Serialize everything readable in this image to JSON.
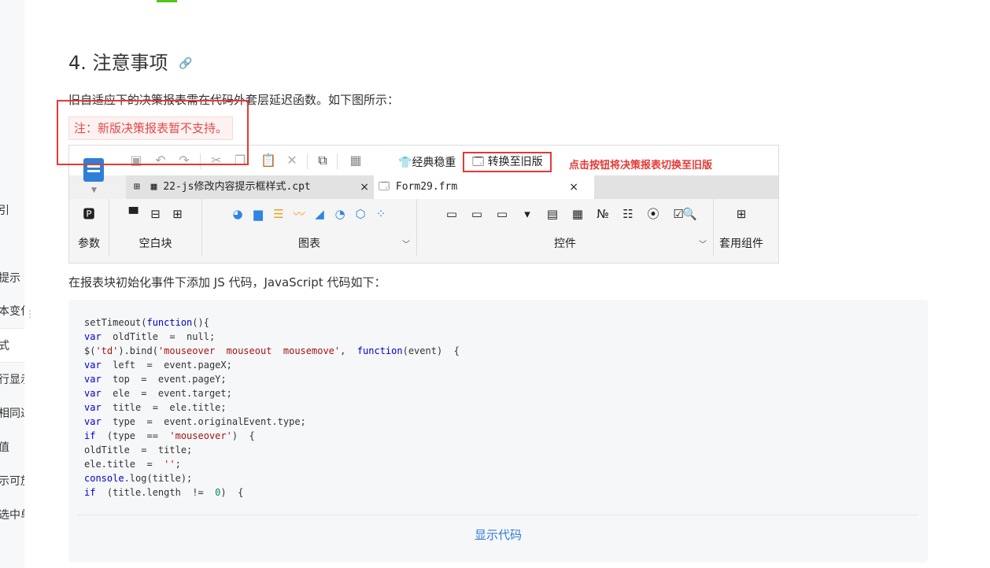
{
  "sidebar": {
    "items": [
      "引",
      "提示",
      "本变化",
      "式",
      "行显示",
      "相同过",
      "值",
      "示可放",
      "选中单"
    ]
  },
  "section": {
    "heading": "4. 注意事项",
    "link_icon": "link-icon",
    "para1": "旧自适应下的决策报表需在代码外套层延迟函数。如下图所示：",
    "note": "注：新版决策报表暂不支持。",
    "para2": "在报表块初始化事件下添加 JS 代码，JavaScript 代码如下："
  },
  "screenshot": {
    "classic_label": "经典稳重",
    "to_old_button": "转换至旧版",
    "annotation": "点击按钮将决策报表切换至旧版",
    "tabs": [
      {
        "label": "22-js修改内容提示框样式.cpt",
        "close": "×"
      },
      {
        "label": "Form29.frm",
        "close": "×"
      }
    ],
    "groups": [
      {
        "label": "参数"
      },
      {
        "label": "空白块"
      },
      {
        "label": "图表"
      },
      {
        "label": "控件"
      },
      {
        "label": "套用组件"
      }
    ]
  },
  "code": {
    "lines": [
      "setTimeout(function(){",
      "var  oldTitle  =  null;",
      "$('td').bind('mouseover  mouseout  mousemove',  function(event)  {",
      "var  left  =  event.pageX;",
      "var  top  =  event.pageY;",
      "var  ele  =  event.target;",
      "var  title  =  ele.title;",
      "var  type  =  event.originalEvent.type;",
      "if  (type  ==  'mouseover')  {",
      "oldTitle  =  title;",
      "ele.title  =  '';",
      "console.log(title);",
      "if  (title.length  !=  0)  {"
    ],
    "show_code": "显示代码"
  },
  "colors": {
    "accent": "#2f7bd8",
    "annotation_red": "#e53935",
    "note_text": "#e34a4a"
  }
}
